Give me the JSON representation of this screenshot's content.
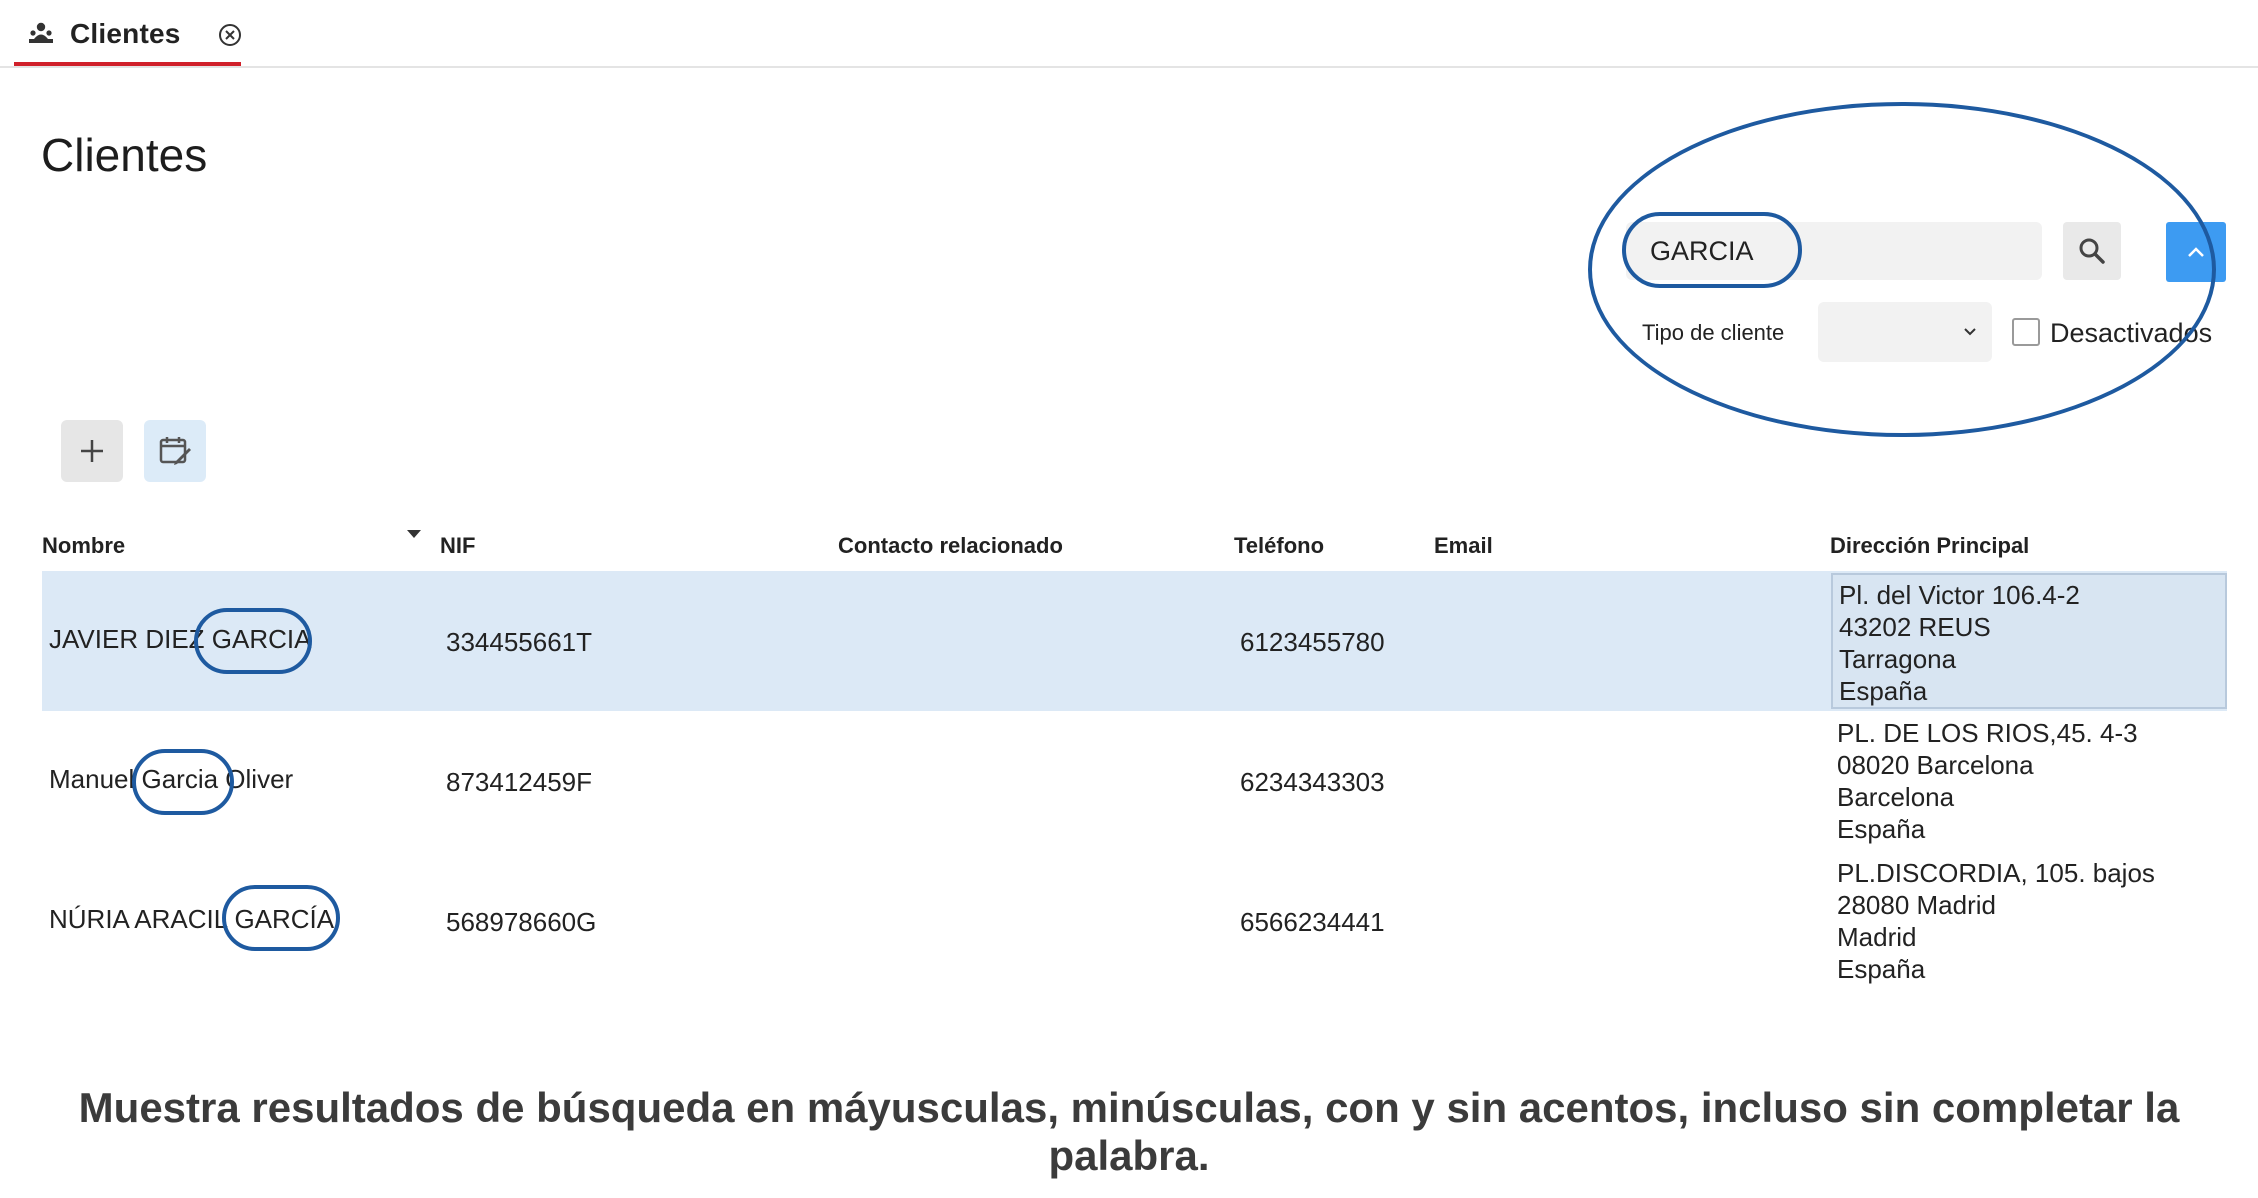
{
  "tab": {
    "label": "Clientes",
    "icon": "users-icon"
  },
  "page": {
    "title": "Clientes"
  },
  "filters": {
    "search_value": "GARCIA",
    "tipo_label": "Tipo de cliente",
    "tipo_value": "",
    "desactivados_label": "Desactivados",
    "desactivados_checked": false
  },
  "toolbar": {
    "add_icon": "plus-icon",
    "calendar_icon": "calendar-edit-icon"
  },
  "table": {
    "columns": [
      "Nombre",
      "NIF",
      "Contacto relacionado",
      "Teléfono",
      "Email",
      "Dirección Principal"
    ],
    "rows": [
      {
        "nombre_pre": "JAVIER DIEZ ",
        "nombre_match": "GARCIA",
        "nombre_post": "",
        "nif": "334455661T",
        "contacto": "",
        "telefono": "6123455780",
        "email": "",
        "direccion": [
          "Pl. del Victor 106.4-2",
          "43202 REUS",
          "Tarragona",
          "España"
        ],
        "selected": true
      },
      {
        "nombre_pre": "Manuel ",
        "nombre_match": "Garcia",
        "nombre_post": " Oliver",
        "nif": "873412459F",
        "contacto": "",
        "telefono": "6234343303",
        "email": "",
        "direccion": [
          "PL. DE LOS RIOS,45. 4-3",
          "08020 Barcelona",
          "Barcelona",
          "España"
        ],
        "selected": false
      },
      {
        "nombre_pre": "NÚRIA ARACIL ",
        "nombre_match": "GARCÍA",
        "nombre_post": "",
        "nif": "568978660G",
        "contacto": "",
        "telefono": "6566234441",
        "email": "",
        "direccion": [
          "PL.DISCORDIA, 105. bajos",
          "28080 Madrid",
          "Madrid",
          "España"
        ],
        "selected": false
      }
    ]
  },
  "caption": "Muestra resultados de búsqueda en máyusculas, minúsculas, con y sin acentos, incluso sin completar la palabra.",
  "colors": {
    "accent_tab": "#d0202a",
    "highlight_outline": "#1e5aa0",
    "primary_button": "#3d9bf2",
    "selected_row": "#dce9f6"
  }
}
